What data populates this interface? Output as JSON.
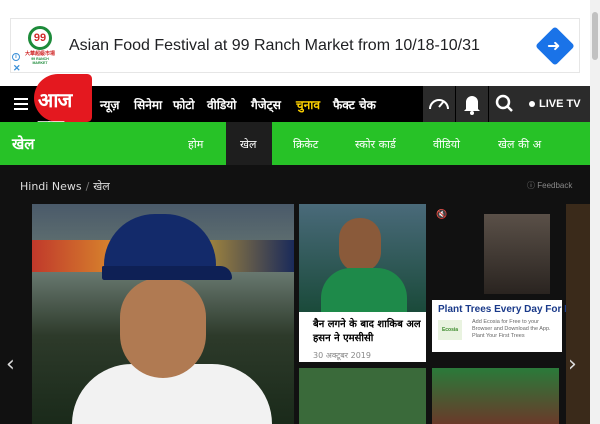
{
  "ad": {
    "logo_number": "99",
    "logo_cn": "大華超級市場",
    "logo_en": "99 RANCH MARKET",
    "title": "Asian Food Festival at 99 Ranch Market from 10/18-10/31",
    "info_glyph": "i",
    "close_glyph": "✕",
    "arrow_glyph": "➜"
  },
  "topnav": {
    "logo_text": "आज तक",
    "items": [
      "न्यूज़",
      "सिनेमा",
      "फोटो",
      "वीडियो",
      "गैजेट्स",
      "चुनाव",
      "फैक्ट चेक"
    ],
    "highlight_index": 5,
    "live_label": "LIVE TV",
    "icons": [
      "speedometer-icon",
      "bell-icon",
      "search-icon"
    ]
  },
  "secnav": {
    "title": "खेल",
    "items": [
      "होम",
      "खेल",
      "क्रिकेट",
      "स्कोर कार्ड",
      "वीडियो",
      "खेल की अ"
    ],
    "active_index": 1
  },
  "breadcrumb": {
    "home": "Hindi News",
    "sep": "/",
    "current": "खेल"
  },
  "feedback": "Feedback",
  "cards": [
    {
      "title": "बैन लगने के बाद शाकिब अल हसन ने एमसीसी",
      "date": "30 अक्टूबर 2019"
    }
  ],
  "ad2": {
    "mute_glyph": "🔇",
    "headline": "Plant Trees Every Day For F",
    "logo": "Ecosia",
    "desc": "Add Ecosia for Free to your Browser and Download the App. Plant Your First Trees"
  },
  "colors": {
    "brand_red": "#e4181f",
    "section_green": "#27c227",
    "nav_bg": "#000000",
    "highlight": "#ffd200"
  }
}
